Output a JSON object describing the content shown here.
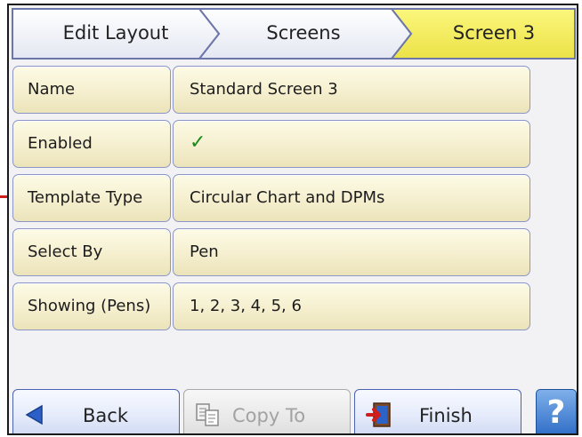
{
  "breadcrumb": {
    "items": [
      {
        "label": "Edit Layout"
      },
      {
        "label": "Screens"
      },
      {
        "label": "Screen 3",
        "active": true
      }
    ],
    "active_color": "#f4ee63"
  },
  "properties": [
    {
      "label": "Name",
      "value": "Standard Screen 3"
    },
    {
      "label": "Enabled",
      "value": "✓"
    },
    {
      "label": "Template Type",
      "value": "Circular Chart and DPMs"
    },
    {
      "label": "Select By",
      "value": "Pen"
    },
    {
      "label": "Showing (Pens)",
      "value": "1, 2, 3, 4, 5, 6"
    }
  ],
  "buttons": {
    "back_label": "Back",
    "copy_to_label": "Copy To",
    "finish_label": "Finish",
    "help_label": "?"
  },
  "icons": {
    "back": "back-arrow-icon",
    "copy_to": "copy-icon",
    "finish": "finish-exit-icon",
    "help": "help-icon"
  }
}
